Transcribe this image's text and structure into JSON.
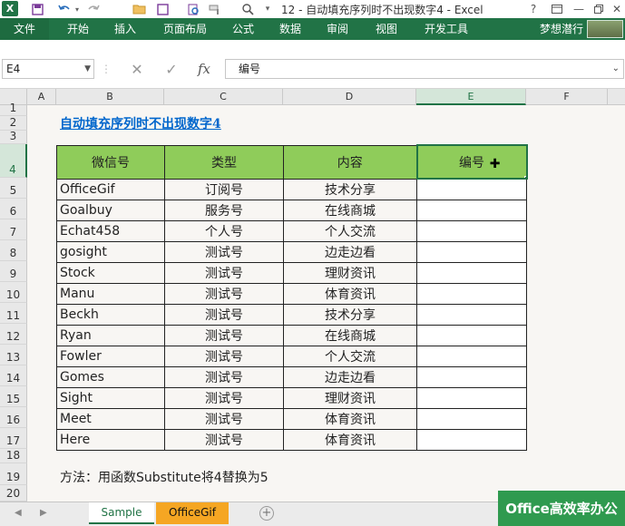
{
  "window": {
    "title": "12 - 自动填充序列时不出现数字4 - Excel",
    "app_icon": "X",
    "quick_access": [
      "save-icon",
      "undo-icon",
      "redo-icon",
      "open-icon",
      "print-preview-icon",
      "customize-icon"
    ]
  },
  "ribbon": {
    "file_tab": "文件",
    "tabs": [
      "开始",
      "插入",
      "页面布局",
      "公式",
      "数据",
      "审阅",
      "视图",
      "开发工具"
    ],
    "user": "梦想潜行"
  },
  "formula_bar": {
    "name_box": "E4",
    "content": "编号"
  },
  "columns": [
    "A",
    "B",
    "C",
    "D",
    "E",
    "F"
  ],
  "rows": [
    "1",
    "2",
    "3",
    "4",
    "5",
    "6",
    "7",
    "8",
    "9",
    "10",
    "11",
    "12",
    "13",
    "14",
    "15",
    "16",
    "17",
    "18",
    "19",
    "20"
  ],
  "sheet": {
    "title": "自动填充序列时不出现数字4",
    "headers": [
      "微信号",
      "类型",
      "内容",
      "编号"
    ],
    "rows": [
      [
        "OfficeGif",
        "订阅号",
        "技术分享",
        ""
      ],
      [
        "Goalbuy",
        "服务号",
        "在线商城",
        ""
      ],
      [
        "Echat458",
        "个人号",
        "个人交流",
        ""
      ],
      [
        "gosight",
        "测试号",
        "边走边看",
        ""
      ],
      [
        "Stock",
        "测试号",
        "理财资讯",
        ""
      ],
      [
        "Manu",
        "测试号",
        "体育资讯",
        ""
      ],
      [
        "Beckh",
        "测试号",
        "技术分享",
        ""
      ],
      [
        "Ryan",
        "测试号",
        "在线商城",
        ""
      ],
      [
        "Fowler",
        "测试号",
        "个人交流",
        ""
      ],
      [
        "Gomes",
        "测试号",
        "边走边看",
        ""
      ],
      [
        "Sight",
        "测试号",
        "理财资讯",
        ""
      ],
      [
        "Meet",
        "测试号",
        "体育资讯",
        ""
      ],
      [
        "Here",
        "测试号",
        "体育资讯",
        ""
      ]
    ],
    "note": "方法：用函数Substitute将4替换为5"
  },
  "sheet_tabs": [
    "Sample",
    "OfficeGif"
  ],
  "brand": "Office高效率办公",
  "colors": {
    "excel_green": "#217346",
    "header_fill": "#8fcc5a",
    "link_blue": "#0066cc",
    "tab_orange": "#f5a623"
  }
}
